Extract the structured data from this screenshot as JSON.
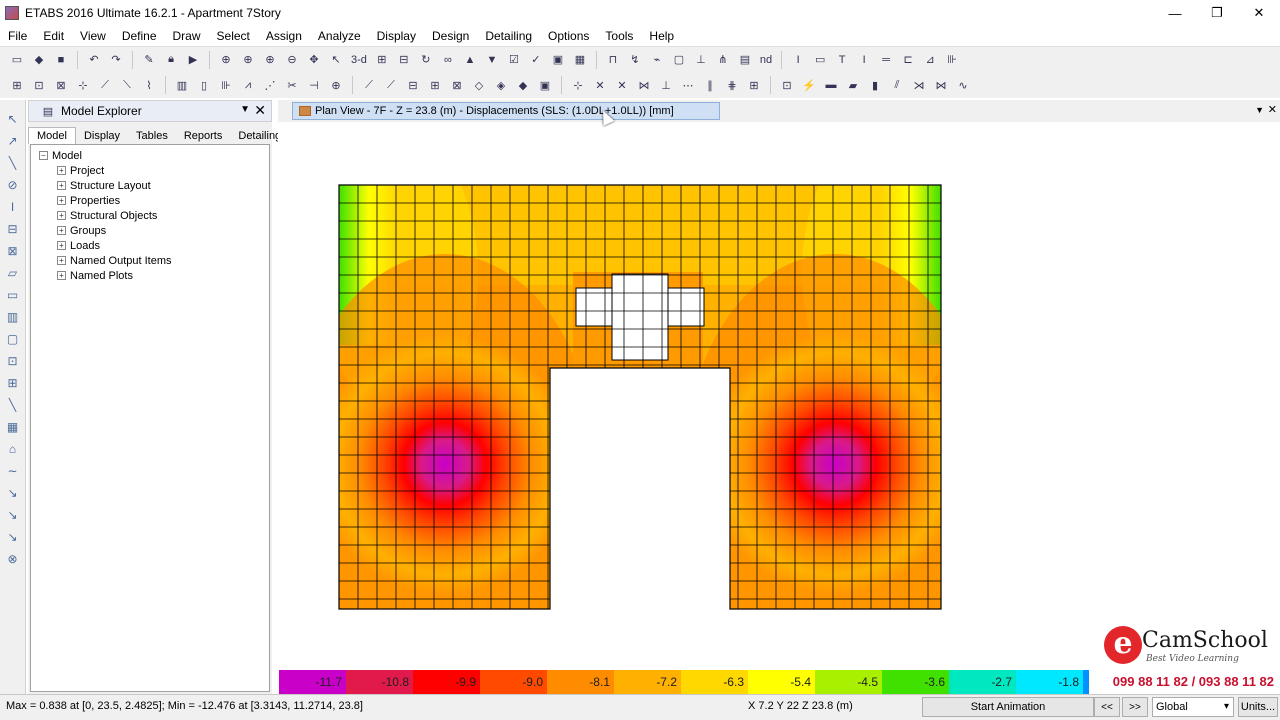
{
  "window": {
    "title": "ETABS 2016 Ultimate 16.2.1 - Apartment 7Story",
    "minimize": "—",
    "restore": "❐",
    "close": "✕"
  },
  "menu": [
    "File",
    "Edit",
    "View",
    "Define",
    "Draw",
    "Select",
    "Assign",
    "Analyze",
    "Display",
    "Design",
    "Detailing",
    "Options",
    "Tools",
    "Help"
  ],
  "toolbar": {
    "view_3d_label": "3-d",
    "nd_label": "nd"
  },
  "explorer": {
    "title": "Model Explorer",
    "pin": "▼",
    "close": "✕",
    "tabs": [
      "Model",
      "Display",
      "Tables",
      "Reports",
      "Detailing"
    ],
    "active_tab": "Model",
    "root": "Model",
    "root_toggle": "−",
    "child_toggle": "+",
    "items": [
      "Project",
      "Structure Layout",
      "Properties",
      "Structural Objects",
      "Groups",
      "Loads",
      "Named Output Items",
      "Named Plots"
    ]
  },
  "document": {
    "tab_title": "Plan View - 7F - Z = 23.8 (m)  - Displacements (SLS: (1.0DL+1.0LL)) [mm]",
    "dropdown": "▼",
    "close": "✕"
  },
  "contour": {
    "max_value": -1.8,
    "min_value": -12.476,
    "palette": [
      "#c800c8",
      "#e21a4c",
      "#ff0000",
      "#ff4a00",
      "#ff8c00",
      "#ffb000",
      "#ffd800",
      "#ffff00",
      "#a8f000",
      "#40e000",
      "#00e4b0",
      "#00e8ff",
      "#0090ff"
    ]
  },
  "legend": {
    "segments": [
      {
        "label": "-11.7",
        "color": "#c800c8"
      },
      {
        "label": "-10.8",
        "color": "#e21a4c"
      },
      {
        "label": "-9.9",
        "color": "#ff0000"
      },
      {
        "label": "-9.0",
        "color": "#ff4a00"
      },
      {
        "label": "-8.1",
        "color": "#ff8c00"
      },
      {
        "label": "-7.2",
        "color": "#ffb000"
      },
      {
        "label": "-6.3",
        "color": "#ffd800"
      },
      {
        "label": "-5.4",
        "color": "#ffff00"
      },
      {
        "label": "-4.5",
        "color": "#a8f000"
      },
      {
        "label": "-3.6",
        "color": "#40e000"
      },
      {
        "label": "-2.7",
        "color": "#00e8c0"
      },
      {
        "label": "-1.8",
        "color": "#00e8ff"
      }
    ],
    "end_color": "#0090ff",
    "phone": "099 88 11 82 / 093 88 11 82"
  },
  "logo": {
    "letter": "e",
    "name": "CamSchool",
    "tagline": "Best Video Learning"
  },
  "status": {
    "max_min": "Max = 0.838 at [0, 23.5, 2.4825];  Min = -12.476 at [3.3143, 11.2714, 23.8]",
    "coords": "X 7.2  Y 22  Z 23.8 (m)",
    "start_animation": "Start Animation",
    "prev": "<<",
    "next": ">>",
    "coord_system": "Global",
    "units": "Units..."
  }
}
